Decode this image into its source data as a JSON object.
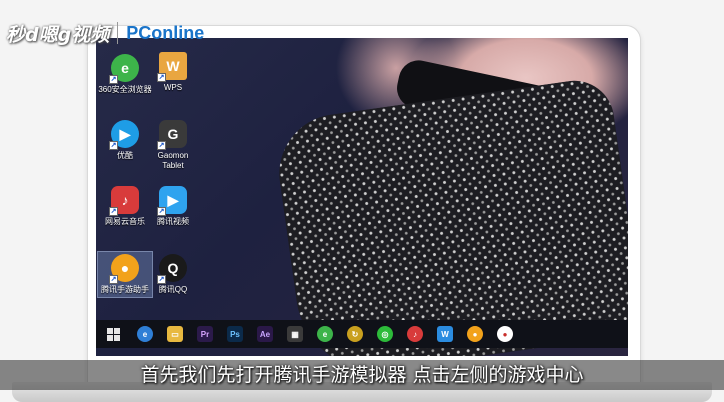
{
  "watermark": {
    "brand": "秒d嗯g视频",
    "partner": "PConline"
  },
  "desktop": {
    "icons": [
      {
        "label": "360安全浏览器",
        "icon": "360-browser-icon",
        "color": "#3db44a",
        "glyph": "e"
      },
      {
        "label": "WPS",
        "icon": "wps-folder-icon",
        "color": "#e9a640",
        "glyph": "W"
      },
      {
        "label": "优酷",
        "icon": "youku-icon",
        "color": "#1e9de6",
        "glyph": "▶"
      },
      {
        "label": "Gaomon Tablet",
        "icon": "gaomon-tablet-icon",
        "color": "#3a3a3a",
        "glyph": "G"
      },
      {
        "label": "网易云音乐",
        "icon": "netease-music-icon",
        "color": "#d83b3b",
        "glyph": "♪"
      },
      {
        "label": "腾讯视频",
        "icon": "tencent-video-icon",
        "color": "#2fa3ef",
        "glyph": "▶"
      },
      {
        "label": "腾讯手游助手",
        "icon": "tencent-game-assistant-icon",
        "color": "#f2a21b",
        "glyph": "●"
      },
      {
        "label": "腾讯QQ",
        "icon": "qq-penguin-icon",
        "color": "#1a1a1a",
        "glyph": "Q"
      }
    ]
  },
  "taskbar": {
    "apps": [
      {
        "name": "edge-icon",
        "glyph": "e",
        "color": "#2f7fd6"
      },
      {
        "name": "file-explorer-icon",
        "glyph": "▭",
        "color": "#e8b940"
      },
      {
        "name": "premiere-icon",
        "glyph": "Pr",
        "color": "#2b1a4a"
      },
      {
        "name": "photoshop-icon",
        "glyph": "Ps",
        "color": "#0b2a4a"
      },
      {
        "name": "after-effects-icon",
        "glyph": "Ae",
        "color": "#2a1848"
      },
      {
        "name": "store-icon",
        "glyph": "▦",
        "color": "#3a3a3a"
      },
      {
        "name": "360-browser-taskbar-icon",
        "glyph": "e",
        "color": "#3db44a"
      },
      {
        "name": "file-transfer-icon",
        "glyph": "↻",
        "color": "#c9a01f"
      },
      {
        "name": "wechat-icon",
        "glyph": "◎",
        "color": "#2dbb3a"
      },
      {
        "name": "netease-music-taskbar-icon",
        "glyph": "♪",
        "color": "#d83b3b"
      },
      {
        "name": "text-editor-icon",
        "glyph": "W",
        "color": "#2b8ce0"
      },
      {
        "name": "game-assistant-taskbar-icon",
        "glyph": "●",
        "color": "#f2a21b"
      },
      {
        "name": "screen-recorder-icon",
        "glyph": "●",
        "color": "#c9302c"
      }
    ]
  },
  "subtitle": "首先我们先打开腾讯手游模拟器 点击左侧的游戏中心"
}
